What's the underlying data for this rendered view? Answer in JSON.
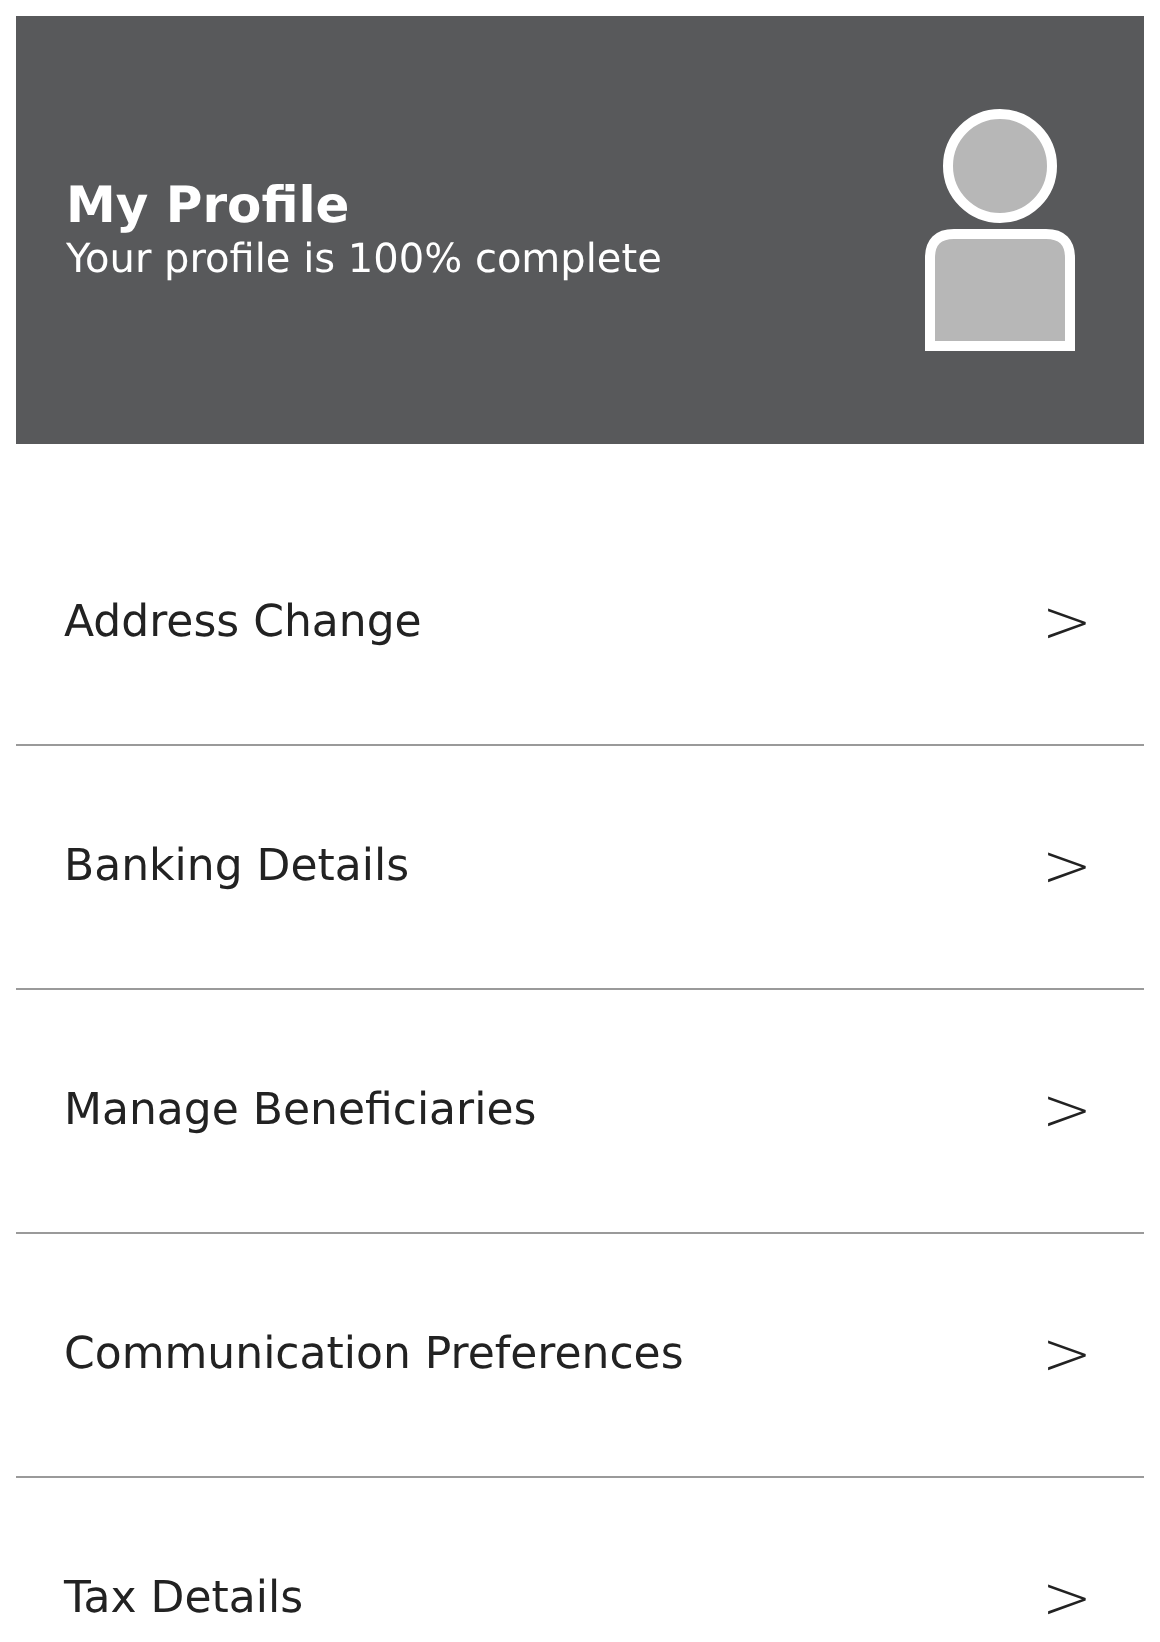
{
  "header": {
    "title": "My Profile",
    "subtitle": "Your profile is 100% complete"
  },
  "menu_items": [
    {
      "label": "Address Change",
      "chevron": ">"
    },
    {
      "label": "Banking Details",
      "chevron": ">"
    },
    {
      "label": "Manage Beneficiaries",
      "chevron": ">"
    },
    {
      "label": "Communication Preferences",
      "chevron": ">"
    },
    {
      "label": "Tax Details",
      "chevron": ">"
    }
  ]
}
